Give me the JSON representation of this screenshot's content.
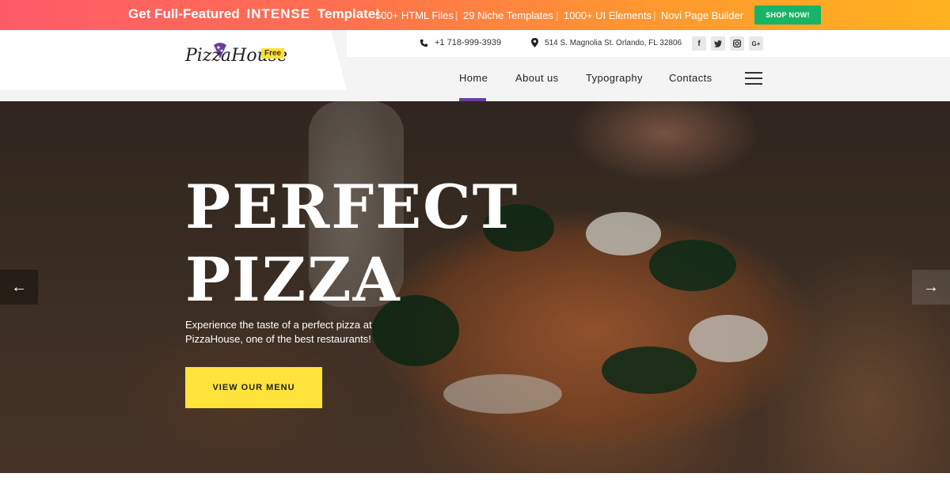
{
  "promo": {
    "headline_prefix": "Get Full-Featured",
    "headline_brand": "INTENSE",
    "headline_suffix": "Template!",
    "features": [
      "500+ HTML Files",
      "29 Niche Templates",
      "1000+ UI Elements",
      "Novi Page Builder"
    ],
    "shop_label": "SHOP NOW!",
    "shop_color": "#19b366"
  },
  "logo": {
    "text": "PizzaHouse",
    "badge": "Free"
  },
  "contact": {
    "phone": "+1 718-999-3939",
    "address": "514 S. Magnolia St. Orlando, FL 32806"
  },
  "social": {
    "icons": [
      "facebook-icon",
      "twitter-icon",
      "instagram-icon",
      "google-plus-icon"
    ],
    "glyphs": [
      "f",
      "t",
      "◎",
      "G+"
    ]
  },
  "nav": {
    "items": [
      "Home",
      "About us",
      "Typography",
      "Contacts"
    ],
    "active": "Home",
    "active_color": "#6a3fa0"
  },
  "hero": {
    "title_line1": "PERFECT",
    "title_line2": "PIZZA",
    "description": "Experience the taste of a perfect pizza at PizzaHouse, one of the best restaurants!",
    "button_label": "VIEW OUR MENU",
    "button_color": "#ffe33a",
    "prev_arrow": "←",
    "next_arrow": "→"
  }
}
